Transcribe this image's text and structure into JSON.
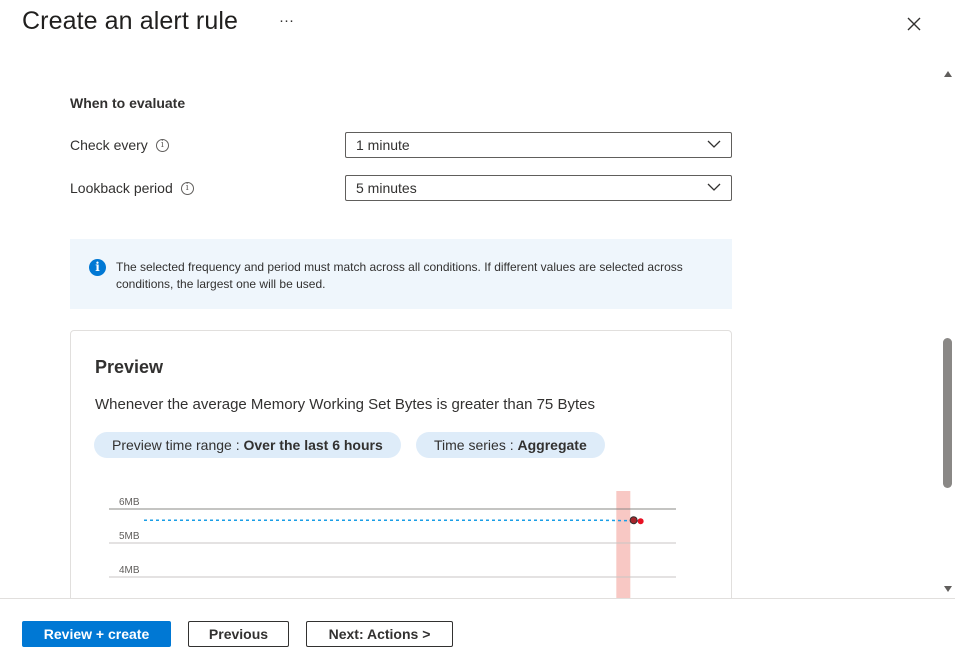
{
  "header": {
    "title": "Create an alert rule",
    "more_label": "···"
  },
  "evaluate": {
    "section_title": "When to evaluate",
    "check_every": {
      "label": "Check every",
      "value": "1 minute"
    },
    "lookback": {
      "label": "Lookback period",
      "value": "5 minutes"
    }
  },
  "info_banner": {
    "text": "The selected frequency and period must match across all conditions. If different values are selected across conditions, the largest one will be used."
  },
  "preview": {
    "title": "Preview",
    "description": "Whenever the average Memory Working Set Bytes is greater than 75 Bytes",
    "time_range_label": "Preview time range : ",
    "time_range_value": "Over the last 6 hours",
    "time_series_label": "Time series : ",
    "time_series_value": "Aggregate"
  },
  "chart_data": {
    "type": "line",
    "y_tick_labels": [
      "6MB",
      "5MB",
      "4MB"
    ],
    "y_ticks": [
      6,
      5,
      4
    ],
    "series": [
      {
        "values": [
          5.67,
          5.67,
          5.67,
          5.67,
          5.67,
          5.67,
          5.67,
          5.67,
          5.67,
          5.67,
          5.67,
          5.65
        ]
      }
    ],
    "highlight_index": 11,
    "colors": {
      "line": "#1a9ee6",
      "highlight_band": "#f8c8c4",
      "marker": "#e81123"
    }
  },
  "footer": {
    "review_create": "Review + create",
    "previous": "Previous",
    "next": "Next: Actions >"
  }
}
